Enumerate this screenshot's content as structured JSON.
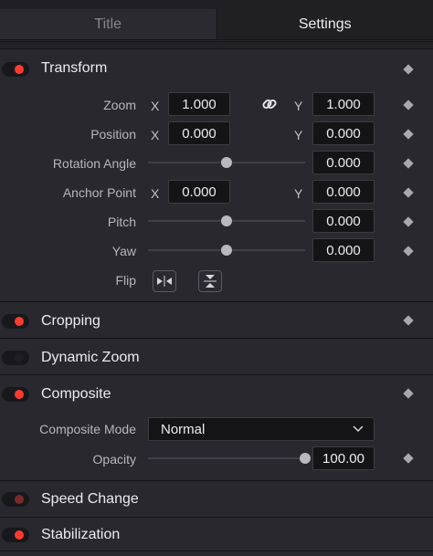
{
  "tabs": [
    {
      "label": "Title",
      "active": false
    },
    {
      "label": "Settings",
      "active": true
    }
  ],
  "transform": {
    "title": "Transform",
    "enabled": true,
    "zoom": {
      "label": "Zoom",
      "x_axis": "X",
      "y_axis": "Y",
      "x": "1.000",
      "y": "1.000",
      "link_icon": "link-icon"
    },
    "position": {
      "label": "Position",
      "x_axis": "X",
      "y_axis": "Y",
      "x": "0.000",
      "y": "0.000"
    },
    "rotation_angle": {
      "label": "Rotation Angle",
      "value": "0.000",
      "slider_fraction": 0.5
    },
    "anchor_point": {
      "label": "Anchor Point",
      "x_axis": "X",
      "y_axis": "Y",
      "x": "0.000",
      "y": "0.000"
    },
    "pitch": {
      "label": "Pitch",
      "value": "0.000",
      "slider_fraction": 0.5
    },
    "yaw": {
      "label": "Yaw",
      "value": "0.000",
      "slider_fraction": 0.5
    },
    "flip": {
      "label": "Flip",
      "horizontal_icon": "flip-horizontal-icon",
      "vertical_icon": "flip-vertical-icon"
    }
  },
  "cropping": {
    "title": "Cropping",
    "enabled": true
  },
  "dynamic_zoom": {
    "title": "Dynamic Zoom",
    "enabled": false
  },
  "composite": {
    "title": "Composite",
    "enabled": true,
    "mode": {
      "label": "Composite Mode",
      "value": "Normal"
    },
    "opacity": {
      "label": "Opacity",
      "value": "100.00",
      "slider_fraction": 1.0
    }
  },
  "speed_change": {
    "title": "Speed Change",
    "enabled": false,
    "dimmed": true
  },
  "stabilization": {
    "title": "Stabilization",
    "enabled": true
  },
  "colors": {
    "toggle_on": "#ff3b30",
    "panel_bg": "#28282e",
    "field_bg": "#141417"
  }
}
